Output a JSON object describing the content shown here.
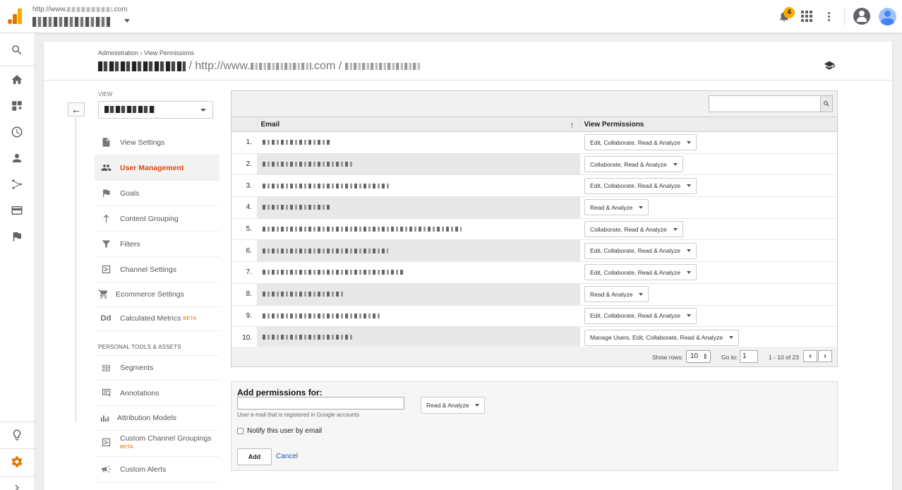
{
  "header": {
    "account_url_prefix": "http://www.",
    "account_url_suffix": ".com",
    "notification_count": "4"
  },
  "breadcrumb": "Administration › View Permissions",
  "title": {
    "url_prefix": "/ http://www.",
    "url_suffix": ".com /"
  },
  "view_panel": {
    "label": "VIEW",
    "items": [
      {
        "label": "View Settings",
        "icon": "document-icon"
      },
      {
        "label": "User Management",
        "icon": "people-icon",
        "active": true
      },
      {
        "label": "Goals",
        "icon": "flag-icon"
      },
      {
        "label": "Content Grouping",
        "icon": "walker-icon"
      },
      {
        "label": "Filters",
        "icon": "filter-icon"
      },
      {
        "label": "Channel Settings",
        "icon": "channel-icon"
      },
      {
        "label": "Ecommerce Settings",
        "icon": "cart-icon"
      },
      {
        "label": "Calculated Metrics",
        "icon": "dd-icon",
        "badge": "BETA"
      }
    ],
    "section_title": "PERSONAL TOOLS & ASSETS",
    "tools": [
      {
        "label": "Segments",
        "icon": "segments-icon"
      },
      {
        "label": "Annotations",
        "icon": "comment-icon"
      },
      {
        "label": "Attribution Models",
        "icon": "bars-icon"
      },
      {
        "label": "Custom Channel Groupings",
        "icon": "channel-icon",
        "badge": "BETA"
      },
      {
        "label": "Custom Alerts",
        "icon": "megaphone-icon"
      }
    ]
  },
  "table": {
    "columns": [
      "Email",
      "View Permissions"
    ],
    "rows": [
      {
        "num": "1.",
        "permission": "Edit, Collaborate, Read & Analyze"
      },
      {
        "num": "2.",
        "permission": "Collaborate, Read & Analyze"
      },
      {
        "num": "3.",
        "permission": "Edit, Collaborate, Read & Analyze"
      },
      {
        "num": "4.",
        "permission": "Read & Analyze"
      },
      {
        "num": "5.",
        "permission": "Collaborate, Read & Analyze"
      },
      {
        "num": "6.",
        "permission": "Edit, Collaborate, Read & Analyze"
      },
      {
        "num": "7.",
        "permission": "Edit, Collaborate, Read & Analyze"
      },
      {
        "num": "8.",
        "permission": "Read & Analyze"
      },
      {
        "num": "9.",
        "permission": "Edit, Collaborate, Read & Analyze"
      },
      {
        "num": "10.",
        "permission": "Manage Users, Edit, Collaborate, Read & Analyze"
      }
    ],
    "pager": {
      "show_rows_label": "Show rows:",
      "rows_value": "10",
      "goto_label": "Go to:",
      "goto_value": "1",
      "range": "1 - 10 of 23",
      "prev": "‹",
      "next": "›"
    }
  },
  "add_permissions": {
    "title": "Add permissions for:",
    "hint": "User e-mail that is registered in Google accounts",
    "permission": "Read & Analyze",
    "notify_label": "Notify this user by email",
    "add_label": "Add",
    "cancel_label": "Cancel"
  },
  "colors": {
    "accent": "#e8430f",
    "brand": "#f9ab00",
    "link": "#1a5ea8"
  }
}
